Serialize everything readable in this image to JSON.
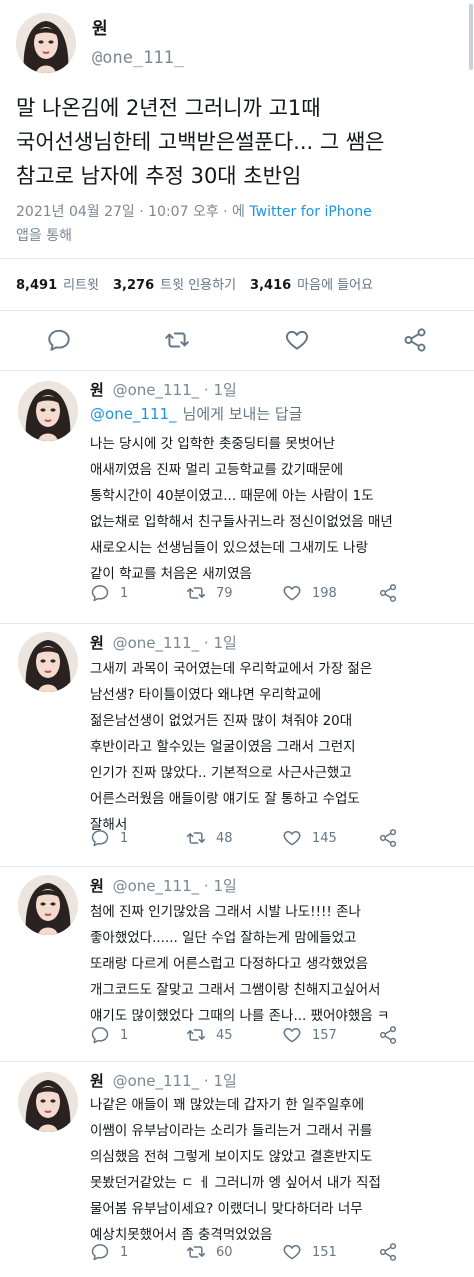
{
  "main_tweet": {
    "author_name": "원",
    "author_handle": "@one_111_",
    "text_lines": [
      "말 나온김에 2년전 그러니까 고1때",
      "국어선생님한테 고백받은썰푼다... 그 쌤은",
      "참고로 남자에 추정 30대 초반임"
    ],
    "timestamp": "2021년 04월 27일 · 10:07 오후 · 에",
    "source": "Twitter for iPhone",
    "source_suffix": "앱을 통해",
    "stats": {
      "retweets_count": "8,491",
      "retweets_label": "리트윗",
      "quotes_count": "3,276",
      "quotes_label": "트윗 인용하기",
      "likes_count": "3,416",
      "likes_label": "마음에 들어요"
    },
    "actions": {
      "reply_icon": "reply-icon",
      "retweet_icon": "retweet-icon",
      "like_icon": "heart-icon",
      "share_icon": "share-icon"
    }
  },
  "replies": [
    {
      "name": "원",
      "handle": "@one_111_",
      "time": "· 1일",
      "reply_to_handle": "@one_111_",
      "reply_to_suffix": "님에게 보내는 답글",
      "lines": [
        "나는 당시에 갓 입학한 촛중딩티를 못벗어난",
        "애새끼였음 진짜 멀리 고등학교를 갔기때문에",
        "통학시간이 40분이였고... 때문에 아는 사람이 1도",
        "없는채로 입학해서 친구들사귀느라 정신이없었음 매년",
        "새로오시는 선생님들이 있으셨는데 그새끼도 나랑",
        "같이 학교를 처음온 새끼였음"
      ],
      "reply_count": "1",
      "retweet_count": "79",
      "like_count": "198"
    },
    {
      "name": "원",
      "handle": "@one_111_",
      "time": "· 1일",
      "lines": [
        "그새끼 과목이 국어였는데 우리학교에서 가장 젊은",
        "남선생? 타이틀이였다 왜냐면 우리학교에",
        "젊은남선생이 없었거든 진짜 많이 쳐줘야 20대",
        "후반이라고 할수있는 얼굴이였음 그래서 그런지",
        "인기가 진짜 많았다.. 기본적으로 사근사근했고",
        "어른스러웠음 애들이랑 얘기도 잘 통하고 수업도",
        "잘해서"
      ],
      "reply_count": "1",
      "retweet_count": "48",
      "like_count": "145"
    },
    {
      "name": "원",
      "handle": "@one_111_",
      "time": "· 1일",
      "lines": [
        "첨에 진짜 인기많았음 그래서 시발 나도!!!! 존나",
        "좋아했었다...... 일단 수업 잘하는게 맘에들었고",
        "또래랑 다르게 어른스럽고 다정하다고 생각했었음",
        "개그코드도 잘맞고 그래서 그쌤이랑 친해지고싶어서",
        "얘기도 많이했었다 그때의 나를 존나... 팼어야했음 ㅋ"
      ],
      "reply_count": "1",
      "retweet_count": "45",
      "like_count": "157"
    },
    {
      "name": "원",
      "handle": "@one_111_",
      "time": "· 1일",
      "lines": [
        "나같은 애들이 꽤 많았는데 갑자기 한 일주일후에",
        "이쌤이 유부남이라는 소리가 들리는거 그래서 귀를",
        "의심했음 전혀 그렇게 보이지도 않았고 결혼반지도",
        "못봤던거같았는 ㄷ ㅔ 그러니까 엥 싶어서 내가 직접",
        "물어봄 유부남이세요? 이랬더니 맞다하더라 너무",
        "예상치못했어서 좀 충격먹었었음"
      ],
      "reply_count": "1",
      "retweet_count": "60",
      "like_count": "151"
    }
  ],
  "colors": {
    "accent": "#1b95e0",
    "text": "#14171a",
    "muted": "#657786",
    "divider": "#e1e8ed"
  }
}
